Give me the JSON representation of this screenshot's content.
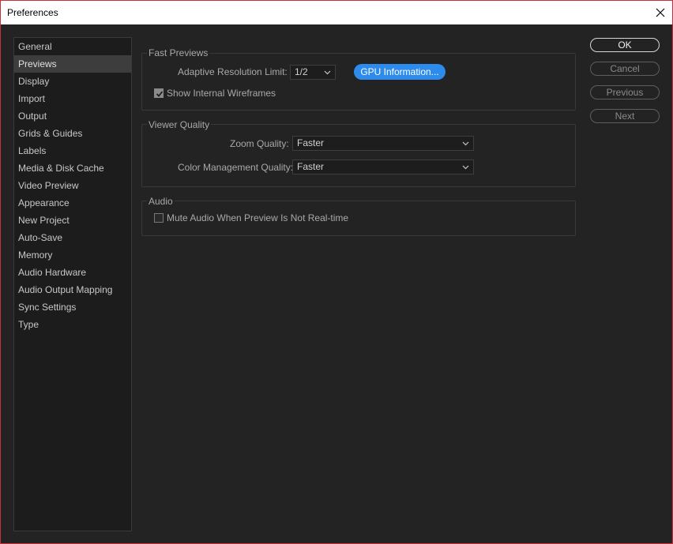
{
  "window": {
    "title": "Preferences"
  },
  "sidebar": {
    "items": [
      {
        "label": "General"
      },
      {
        "label": "Previews"
      },
      {
        "label": "Display"
      },
      {
        "label": "Import"
      },
      {
        "label": "Output"
      },
      {
        "label": "Grids & Guides"
      },
      {
        "label": "Labels"
      },
      {
        "label": "Media & Disk Cache"
      },
      {
        "label": "Video Preview"
      },
      {
        "label": "Appearance"
      },
      {
        "label": "New Project"
      },
      {
        "label": "Auto-Save"
      },
      {
        "label": "Memory"
      },
      {
        "label": "Audio Hardware"
      },
      {
        "label": "Audio Output Mapping"
      },
      {
        "label": "Sync Settings"
      },
      {
        "label": "Type"
      }
    ],
    "selected": "Previews"
  },
  "fast_previews": {
    "title": "Fast Previews",
    "resolution_label": "Adaptive Resolution Limit:",
    "resolution_value": "1/2",
    "gpu_button": "GPU Information...",
    "wireframes_label": "Show Internal Wireframes",
    "wireframes_checked": true
  },
  "viewer_quality": {
    "title": "Viewer Quality",
    "zoom_label": "Zoom Quality:",
    "zoom_value": "Faster",
    "color_label": "Color Management Quality:",
    "color_value": "Faster"
  },
  "audio": {
    "title": "Audio",
    "mute_label": "Mute Audio When Preview Is Not Real-time",
    "mute_checked": false
  },
  "buttons": {
    "ok": "OK",
    "cancel": "Cancel",
    "previous": "Previous",
    "next": "Next"
  },
  "icons": {
    "close": "close-icon",
    "dropdown": "chevron-down-icon",
    "check": "check-icon"
  },
  "colors": {
    "accent": "#2d8ceb",
    "window_border": "#c8303a",
    "background": "#232323"
  }
}
